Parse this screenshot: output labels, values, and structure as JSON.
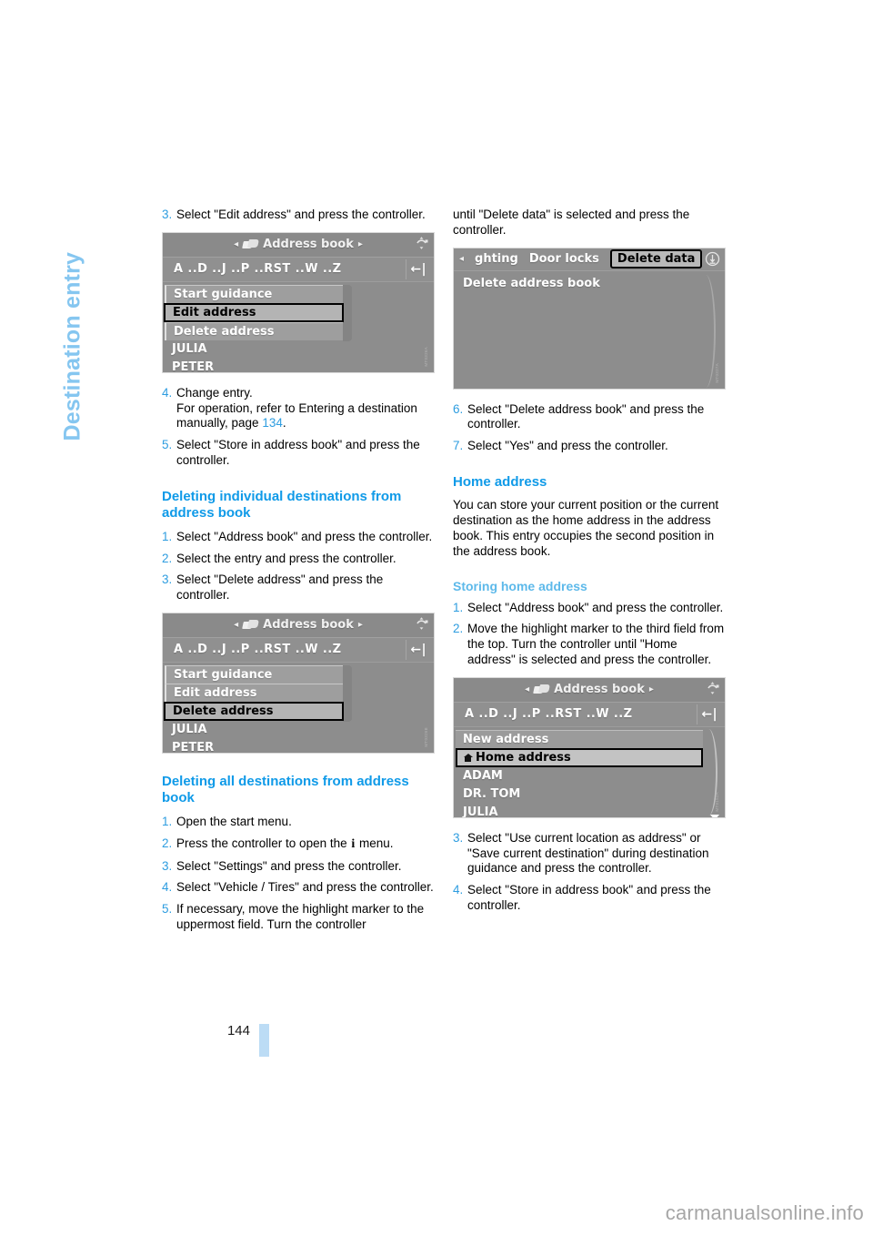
{
  "chapter": {
    "title": "Destination entry"
  },
  "folio": {
    "page_number": "144",
    "bar_color": "#bcdcf5"
  },
  "watermark": {
    "text": "carmanualsonline.info"
  },
  "left_column": {
    "step3": {
      "num": "3.",
      "text": "Select \"Edit address\" and press the controller."
    },
    "screenshot1": {
      "title": "Address book",
      "alpha": "A ..D ..J ..P ..RST ..W ..Z",
      "rows": [
        {
          "label": "Start guidance",
          "type": "popup"
        },
        {
          "label": "Edit address",
          "type": "popup-selected"
        },
        {
          "label": "Delete address",
          "type": "popup"
        },
        {
          "label": "JULIA",
          "type": "plain"
        },
        {
          "label": "PETER",
          "type": "plain"
        }
      ],
      "code": "MT0326A"
    },
    "step4": {
      "num": "4.",
      "line1": "Change entry.",
      "line2": "For operation, refer to Entering a destination manually, page ",
      "pageref": "134",
      "line3": "."
    },
    "step5": {
      "num": "5.",
      "text": "Select \"Store in address book\" and press the controller."
    },
    "heading_delete_individual": "Deleting individual destinations from address book",
    "di_step1": {
      "num": "1.",
      "text": "Select \"Address book\" and press the controller."
    },
    "di_step2": {
      "num": "2.",
      "text": "Select the entry and press the controller."
    },
    "di_step3": {
      "num": "3.",
      "text": "Select \"Delete address\" and press the controller."
    },
    "screenshot2": {
      "title": "Address book",
      "alpha": "A ..D ..J ..P ..RST ..W ..Z",
      "rows": [
        {
          "label": "Start guidance",
          "type": "popup"
        },
        {
          "label": "Edit address",
          "type": "popup"
        },
        {
          "label": "Delete address",
          "type": "popup-selected"
        },
        {
          "label": "JULIA",
          "type": "plain"
        },
        {
          "label": "PETER",
          "type": "plain"
        }
      ],
      "code": "MT0326B"
    },
    "heading_delete_all": "Deleting all destinations from address book",
    "da_step1": {
      "num": "1.",
      "text": "Open the start menu."
    },
    "da_step2": {
      "num": "2.",
      "prefix": "Press the controller to open the ",
      "icon": "i",
      "suffix": " menu."
    },
    "da_step3": {
      "num": "3.",
      "text": "Select \"Settings\" and press the controller."
    },
    "da_step4": {
      "num": "4.",
      "text": "Select \"Vehicle / Tires\" and press the controller."
    },
    "da_step5": {
      "num": "5.",
      "text": "If necessary, move the highlight marker to the uppermost field. Turn the controller"
    }
  },
  "right_column": {
    "continuation": "until \"Delete data\" is selected and press the controller.",
    "screenshot3": {
      "tabs": [
        {
          "label": "ghting",
          "selected": false
        },
        {
          "label": "Door locks",
          "selected": false
        },
        {
          "label": "Delete data",
          "selected": true
        }
      ],
      "body_item": "Delete address book",
      "code": "MT0327A"
    },
    "da_step6": {
      "num": "6.",
      "text": "Select \"Delete address book\" and press the controller."
    },
    "da_step7": {
      "num": "7.",
      "text": "Select \"Yes\" and press the controller."
    },
    "heading_home": "Home address",
    "home_para": "You can store your current position or the current destination as the home address in the address book. This entry occupies the second position in the address book.",
    "subheading_storing": "Storing home address",
    "sh_step1": {
      "num": "1.",
      "text": "Select \"Address book\" and press the controller."
    },
    "sh_step2": {
      "num": "2.",
      "text": "Move the highlight marker to the third field from the top. Turn the controller until \"Home address\" is selected and press the controller."
    },
    "screenshot4": {
      "title": "Address book",
      "alpha": "A ..D ..J ..P ..RST ..W ..Z",
      "rows": [
        {
          "label": "New address",
          "type": "wide"
        },
        {
          "label": "Home address",
          "type": "wide-selected",
          "icon": "home-icon"
        },
        {
          "label": "ADAM",
          "type": "plain"
        },
        {
          "label": "DR. TOM",
          "type": "plain"
        },
        {
          "label": "JULIA",
          "type": "plain"
        }
      ],
      "code": "MT0152A"
    },
    "sh_step3": {
      "num": "3.",
      "text": "Select \"Use current location as address\" or \"Save current destination\" during destination guidance and press the controller."
    },
    "sh_step4": {
      "num": "4.",
      "text": "Select \"Store in address book\" and press the controller."
    }
  }
}
